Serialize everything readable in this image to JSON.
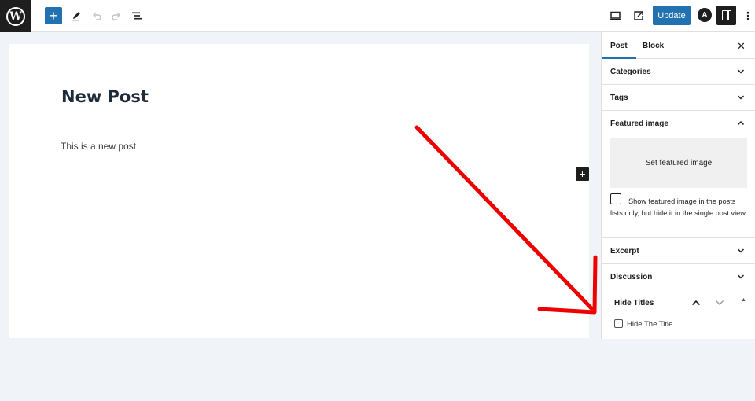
{
  "toolbar": {
    "logo_icon": "wordpress-logo-icon",
    "logo_glyph": "W",
    "add_icon": "plus-icon",
    "tools_icon": "pencil-icon",
    "undo_icon": "undo-icon",
    "redo_icon": "redo-icon",
    "outline_icon": "list-view-icon",
    "preview_icon": "desktop-preview-icon",
    "view_post_icon": "external-link-icon",
    "update_label": "Update",
    "astra_glyph": "A",
    "astra_icon": "astra-logo-icon",
    "settings_icon": "sidebar-toggle-icon",
    "more_icon": "more-vertical-icon"
  },
  "editor": {
    "title": "New Post",
    "body": "This is a new post",
    "inserter_icon": "plus-icon"
  },
  "sidebar": {
    "tabs": [
      "Post",
      "Block"
    ],
    "close_icon": "close-icon",
    "panels": [
      {
        "label": "Categories",
        "state": "collapsed"
      },
      {
        "label": "Tags",
        "state": "collapsed"
      },
      {
        "label": "Featured image",
        "state": "expanded"
      },
      {
        "label": "Excerpt",
        "state": "collapsed"
      },
      {
        "label": "Discussion",
        "state": "collapsed"
      }
    ],
    "featured": {
      "set_label": "Set featured image",
      "checkbox_label": "Show featured image in the posts lists only, but hide it in the single post view."
    },
    "hide_titles": {
      "heading": "Hide Titles",
      "checkbox_label": "Hide The Title"
    }
  },
  "annotation": {
    "arrow_color": "#ee0000"
  },
  "colors": {
    "accent": "#2271b1",
    "dark": "#1e1e1e",
    "background": "#f0f4f8"
  }
}
